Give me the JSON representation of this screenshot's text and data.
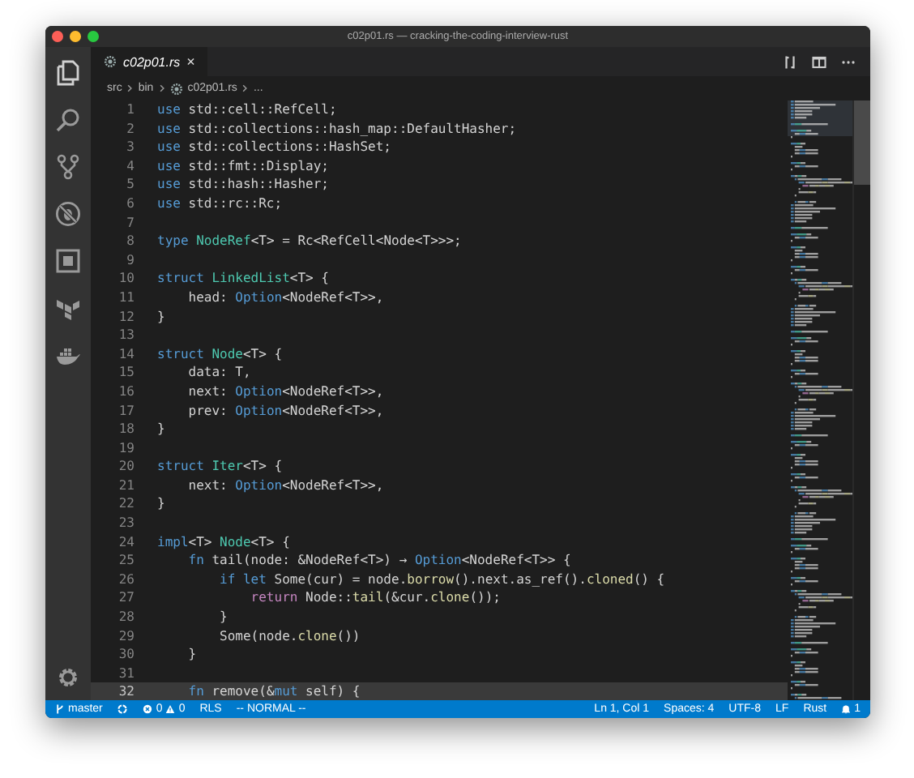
{
  "window": {
    "title": "c02p01.rs — cracking-the-coding-interview-rust"
  },
  "tabs": [
    {
      "label": "c02p01.rs",
      "selected": true,
      "close": "×"
    }
  ],
  "breadcrumbs": [
    "src",
    "bin",
    "c02p01.rs",
    "..."
  ],
  "code": [
    {
      "number": "1",
      "highlighted": false,
      "tokens": [
        {
          "kind": "kw",
          "text": "use"
        },
        {
          "kind": "plain",
          "text": " std::cell::RefCell;"
        }
      ]
    },
    {
      "number": "2",
      "highlighted": false,
      "tokens": [
        {
          "kind": "kw",
          "text": "use"
        },
        {
          "kind": "plain",
          "text": " std::collections::hash_map::DefaultHasher;"
        }
      ]
    },
    {
      "number": "3",
      "highlighted": false,
      "tokens": [
        {
          "kind": "kw",
          "text": "use"
        },
        {
          "kind": "plain",
          "text": " std::collections::HashSet;"
        }
      ]
    },
    {
      "number": "4",
      "highlighted": false,
      "tokens": [
        {
          "kind": "kw",
          "text": "use"
        },
        {
          "kind": "plain",
          "text": " std::fmt::Display;"
        }
      ]
    },
    {
      "number": "5",
      "highlighted": false,
      "tokens": [
        {
          "kind": "kw",
          "text": "use"
        },
        {
          "kind": "plain",
          "text": " std::hash::Hasher;"
        }
      ]
    },
    {
      "number": "6",
      "highlighted": false,
      "tokens": [
        {
          "kind": "kw",
          "text": "use"
        },
        {
          "kind": "plain",
          "text": " std::rc::Rc;"
        }
      ]
    },
    {
      "number": "7",
      "highlighted": false
    },
    {
      "number": "8",
      "highlighted": false,
      "tokens": [
        {
          "kind": "kw",
          "text": "type "
        },
        {
          "kind": "type",
          "text": "NodeRef"
        },
        {
          "kind": "plain",
          "text": "<T> = Rc<RefCell<Node<T>>>;"
        }
      ]
    },
    {
      "number": "9",
      "highlighted": false
    },
    {
      "number": "10",
      "highlighted": false,
      "tokens": [
        {
          "kind": "kw",
          "text": "struct "
        },
        {
          "kind": "type",
          "text": "LinkedList"
        },
        {
          "kind": "plain",
          "text": "<T> {"
        }
      ]
    },
    {
      "number": "11",
      "highlighted": false,
      "tokens": [
        {
          "kind": "plain",
          "text": "    head: "
        },
        {
          "kind": "kw",
          "text": "Option"
        },
        {
          "kind": "plain",
          "text": "<NodeRef<T>>,"
        }
      ]
    },
    {
      "number": "12",
      "highlighted": false,
      "tokens": [
        {
          "kind": "plain",
          "text": "}"
        }
      ]
    },
    {
      "number": "13",
      "highlighted": false
    },
    {
      "number": "14",
      "highlighted": false,
      "tokens": [
        {
          "kind": "kw",
          "text": "struct "
        },
        {
          "kind": "type",
          "text": "Node"
        },
        {
          "kind": "plain",
          "text": "<T> {"
        }
      ]
    },
    {
      "number": "15",
      "highlighted": false,
      "tokens": [
        {
          "kind": "plain",
          "text": "    data: T,"
        }
      ]
    },
    {
      "number": "16",
      "highlighted": false,
      "tokens": [
        {
          "kind": "plain",
          "text": "    next: "
        },
        {
          "kind": "kw",
          "text": "Option"
        },
        {
          "kind": "plain",
          "text": "<NodeRef<T>>,"
        }
      ]
    },
    {
      "number": "17",
      "highlighted": false,
      "tokens": [
        {
          "kind": "plain",
          "text": "    prev: "
        },
        {
          "kind": "kw",
          "text": "Option"
        },
        {
          "kind": "plain",
          "text": "<NodeRef<T>>,"
        }
      ]
    },
    {
      "number": "18",
      "highlighted": false,
      "tokens": [
        {
          "kind": "plain",
          "text": "}"
        }
      ]
    },
    {
      "number": "19",
      "highlighted": false
    },
    {
      "number": "20",
      "highlighted": false,
      "tokens": [
        {
          "kind": "kw",
          "text": "struct "
        },
        {
          "kind": "type",
          "text": "Iter"
        },
        {
          "kind": "plain",
          "text": "<T> {"
        }
      ]
    },
    {
      "number": "21",
      "highlighted": false,
      "tokens": [
        {
          "kind": "plain",
          "text": "    next: "
        },
        {
          "kind": "kw",
          "text": "Option"
        },
        {
          "kind": "plain",
          "text": "<NodeRef<T>>,"
        }
      ]
    },
    {
      "number": "22",
      "highlighted": false,
      "tokens": [
        {
          "kind": "plain",
          "text": "}"
        }
      ]
    },
    {
      "number": "23",
      "highlighted": false
    },
    {
      "number": "24",
      "highlighted": false,
      "tokens": [
        {
          "kind": "kw",
          "text": "impl"
        },
        {
          "kind": "plain",
          "text": "<T> "
        },
        {
          "kind": "type",
          "text": "Node"
        },
        {
          "kind": "plain",
          "text": "<T> {"
        }
      ]
    },
    {
      "number": "25",
      "highlighted": false,
      "tokens": [
        {
          "kind": "kw",
          "text": "    fn"
        },
        {
          "kind": "plain",
          "text": " tail(node: &NodeRef<T>) → "
        },
        {
          "kind": "kw",
          "text": "Option"
        },
        {
          "kind": "plain",
          "text": "<NodeRef<T>> {"
        }
      ]
    },
    {
      "number": "26",
      "highlighted": false,
      "tokens": [
        {
          "kind": "kw",
          "text": "        if let"
        },
        {
          "kind": "plain",
          "text": " Some(cur) = node."
        },
        {
          "kind": "fn",
          "text": "borrow"
        },
        {
          "kind": "plain",
          "text": "().next.as_ref()."
        },
        {
          "kind": "fn",
          "text": "cloned"
        },
        {
          "kind": "plain",
          "text": "() {"
        }
      ]
    },
    {
      "number": "27",
      "highlighted": false,
      "tokens": [
        {
          "kind": "ctrl",
          "text": "            return"
        },
        {
          "kind": "plain",
          "text": " Node::"
        },
        {
          "kind": "fn",
          "text": "tail"
        },
        {
          "kind": "plain",
          "text": "(&cur."
        },
        {
          "kind": "fn",
          "text": "clone"
        },
        {
          "kind": "plain",
          "text": "());"
        }
      ]
    },
    {
      "number": "28",
      "highlighted": false,
      "tokens": [
        {
          "kind": "plain",
          "text": "        }"
        }
      ]
    },
    {
      "number": "29",
      "highlighted": false,
      "tokens": [
        {
          "kind": "plain",
          "text": "        Some(node."
        },
        {
          "kind": "fn",
          "text": "clone"
        },
        {
          "kind": "plain",
          "text": "())"
        }
      ]
    },
    {
      "number": "30",
      "highlighted": false,
      "tokens": [
        {
          "kind": "plain",
          "text": "    }"
        }
      ]
    },
    {
      "number": "31",
      "highlighted": false
    },
    {
      "number": "32",
      "highlighted": true,
      "tokens": [
        {
          "kind": "kw",
          "text": "    fn"
        },
        {
          "kind": "plain",
          "text": " remove(&"
        },
        {
          "kind": "kw",
          "text": "mut"
        },
        {
          "kind": "plain",
          "text": " self) {"
        }
      ]
    }
  ],
  "status_left": [
    {
      "kind": "branch",
      "text": "master"
    },
    {
      "kind": "sync"
    },
    {
      "kind": "problems",
      "errors": "0",
      "warnings": "0"
    },
    {
      "kind": "text",
      "text": "RLS"
    },
    {
      "kind": "text",
      "text": "-- NORMAL --"
    }
  ],
  "status_right": [
    {
      "kind": "text",
      "text": "Ln 1, Col 1"
    },
    {
      "kind": "text",
      "text": "Spaces: 4"
    },
    {
      "kind": "text",
      "text": "UTF-8"
    },
    {
      "kind": "text",
      "text": "LF"
    },
    {
      "kind": "text",
      "text": "Rust"
    },
    {
      "kind": "bell",
      "text": "1"
    }
  ]
}
